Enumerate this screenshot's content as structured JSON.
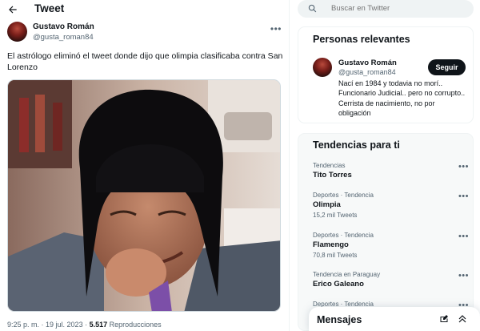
{
  "header": {
    "title": "Tweet"
  },
  "tweet": {
    "author_name": "Gustavo Román",
    "author_handle": "@gusta_roman84",
    "text": "El astrólogo eliminó el tweet donde dijo que olimpia clasificaba contra San Lorenzo",
    "time": "9:25 p. m.",
    "sep1": " · ",
    "date": "19 jul. 2023",
    "sep2": " · ",
    "views": "5.517",
    "views_label": " Reproducciones"
  },
  "search": {
    "placeholder": "Buscar en Twitter"
  },
  "relevant": {
    "title": "Personas relevantes",
    "name": "Gustavo Román",
    "handle": "@gusta_roman84",
    "follow_label": "Seguir",
    "bio": "Nací en 1984 y todavia no morí.. Funcionario Judicial.. pero no corrupto.. Cerrista de nacimiento, no por obligación"
  },
  "trends": {
    "title": "Tendencias para ti",
    "items": [
      {
        "context": "Tendencias",
        "name": "Tito Torres",
        "count": ""
      },
      {
        "context": "Deportes · Tendencia",
        "name": "Olimpia",
        "count": "15,2 mil Tweets"
      },
      {
        "context": "Deportes · Tendencia",
        "name": "Flamengo",
        "count": "70,8 mil Tweets"
      },
      {
        "context": "Tendencia en Paraguay",
        "name": "Erico Galeano",
        "count": ""
      },
      {
        "context": "Deportes · Tendencia",
        "name": "",
        "count": ""
      }
    ]
  },
  "messages": {
    "title": "Mensajes"
  },
  "colors": {
    "accent": "#0f1419",
    "muted": "#536471",
    "border": "#eff3f4"
  }
}
